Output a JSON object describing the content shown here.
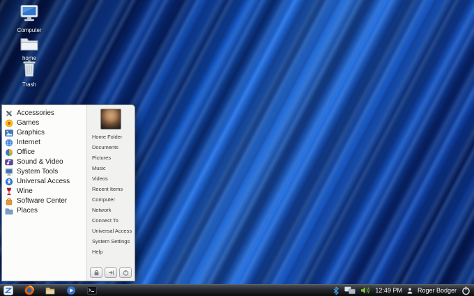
{
  "desktop": {
    "icons": [
      {
        "label": "Computer",
        "icon": "computer-icon"
      },
      {
        "label": "home",
        "icon": "home-folder-icon"
      },
      {
        "label": "Trash",
        "icon": "trash-icon"
      }
    ]
  },
  "menu": {
    "categories": [
      {
        "label": "Accessories",
        "icon": "accessories-icon"
      },
      {
        "label": "Games",
        "icon": "games-icon"
      },
      {
        "label": "Graphics",
        "icon": "graphics-icon"
      },
      {
        "label": "Internet",
        "icon": "internet-icon"
      },
      {
        "label": "Office",
        "icon": "office-icon"
      },
      {
        "label": "Sound & Video",
        "icon": "sound-video-icon"
      },
      {
        "label": "System Tools",
        "icon": "system-tools-icon"
      },
      {
        "label": "Universal Access",
        "icon": "universal-access-icon"
      },
      {
        "label": "Wine",
        "icon": "wine-icon"
      },
      {
        "label": "Software Center",
        "icon": "software-center-icon"
      },
      {
        "label": "Places",
        "icon": "places-icon"
      }
    ],
    "places": [
      "Home Folder",
      "Documents",
      "Pictures",
      "Music",
      "Videos",
      "Recent Items",
      "Computer",
      "Network",
      "Connect To",
      "Universal Access",
      "System Settings",
      "Help"
    ],
    "session_buttons": [
      {
        "icon": "lock-icon"
      },
      {
        "icon": "logout-icon"
      },
      {
        "icon": "shutdown-icon"
      }
    ]
  },
  "taskbar": {
    "launchers": [
      {
        "icon": "start-menu-icon"
      },
      {
        "icon": "firefox-icon"
      },
      {
        "icon": "file-manager-icon"
      },
      {
        "icon": "media-player-icon"
      },
      {
        "icon": "terminal-icon"
      }
    ],
    "tray": {
      "bluetooth": "bluetooth-icon",
      "network": "network-icon",
      "volume": "volume-icon",
      "clock": "12:49 PM",
      "username": "Roger Bodger",
      "power": "power-icon"
    }
  },
  "colors": {
    "accent": "#2f74d0",
    "wallpaper_bright": "#2e7ff0",
    "wallpaper_dark": "#03102e",
    "taskbar_bg": "#15181c",
    "menu_bg": "#fbfbfa"
  }
}
